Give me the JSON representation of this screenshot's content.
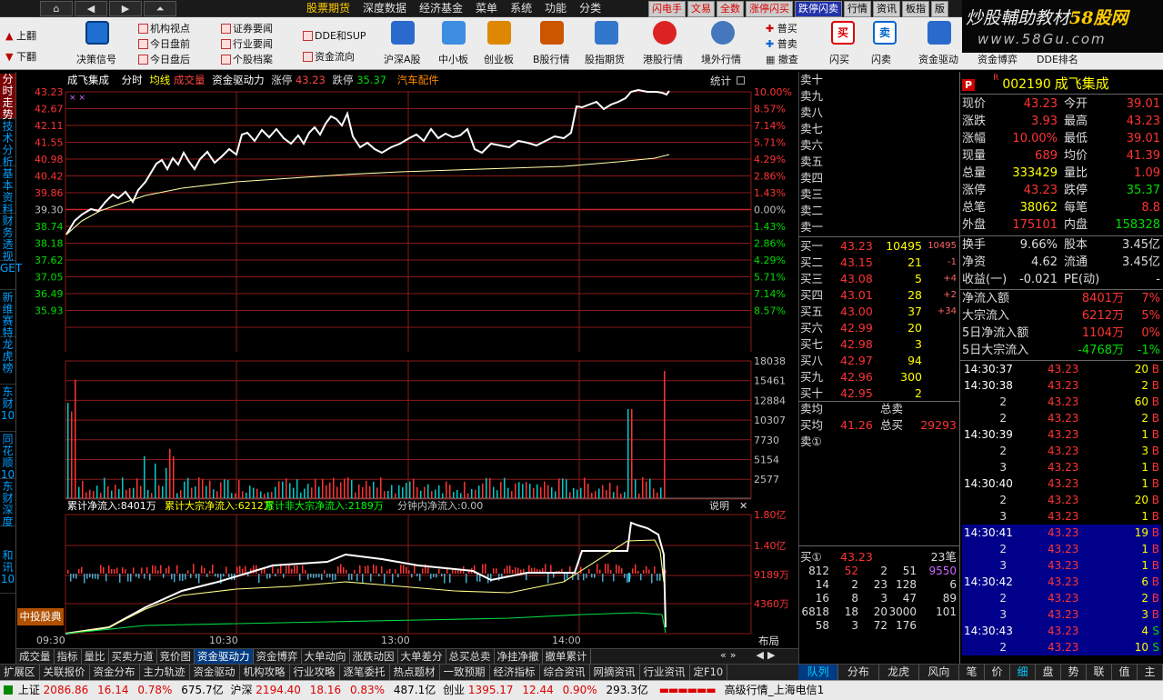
{
  "menubar": {
    "nav_home": "⌂",
    "nav_back": "◀",
    "nav_fwd": "▶",
    "nav_up": "⏶",
    "items": [
      "股票期货",
      "深度数据",
      "经济基金",
      "菜单",
      "系统",
      "功能",
      "分类"
    ],
    "hot": [
      "闪电手",
      "文易",
      "全数",
      "涨停闪买",
      "跌停闪卖",
      "行情",
      "资讯",
      "板指",
      "版"
    ]
  },
  "watermark": {
    "line1a": "炒股輔助教材",
    "line1b": "58股网",
    "line2": "www.58Gu.com"
  },
  "toolbar": {
    "page_up": "上翻",
    "page_down": "下翻",
    "decision": "决策信号",
    "col1": [
      "机构视点",
      "今日盘前",
      "今日盘后"
    ],
    "col2": [
      "证券要闻",
      "行业要闻",
      "个股档案"
    ],
    "col3": [
      "DDE和SUP",
      "资金流向"
    ],
    "big": [
      "沪深A股",
      "中小板",
      "创业板",
      "B股行情",
      "股指期货",
      "港股行情",
      "境外行情"
    ],
    "trade": [
      "普买",
      "普卖",
      "撤查"
    ],
    "flash": [
      "闪买",
      "闪卖"
    ],
    "fund": [
      "资金驱动",
      "资金博弈",
      "DDE排名"
    ]
  },
  "leftrail": [
    "分时走势",
    "技术分析",
    "基本资料",
    "财务透视",
    "GET",
    "新维赛特",
    "龙虎榜",
    "东财10",
    "同花顺10",
    "东财深度",
    "和讯10"
  ],
  "chart": {
    "title": {
      "name": "成飞集成",
      "mode": "分时",
      "avg": "均线",
      "vol": "成交量",
      "fund": "资金驱动力",
      "zt_label": "涨停",
      "zt": "43.23",
      "dt_label": "跌停",
      "dt": "35.37",
      "industry": "汽车配件",
      "stats": "统计"
    },
    "price_left": [
      "43.23",
      "42.67",
      "42.11",
      "41.55",
      "40.98",
      "40.42",
      "39.86",
      "39.30",
      "38.74",
      "38.18",
      "37.62",
      "37.05",
      "36.49",
      "35.93"
    ],
    "price_right": [
      "10.00%",
      "8.57%",
      "7.14%",
      "5.71%",
      "4.29%",
      "2.86%",
      "1.43%",
      "0.00%",
      "1.43%",
      "2.86%",
      "4.29%",
      "5.71%",
      "7.14%",
      "8.57%"
    ],
    "vol_right": [
      "18038",
      "15461",
      "12884",
      "10307",
      "7730",
      "5154",
      "2577"
    ],
    "flow_title": {
      "a": "累计净流入:8401万",
      "b": "累计大宗净流入:6212万",
      "c": "累计非大宗净流入:2189万",
      "d": "分钟内净流入:0.00",
      "e": "说明",
      "x": "✕"
    },
    "flow_right": [
      "1.80亿",
      "1.40亿",
      "9189万",
      "4360万"
    ],
    "badge": "中投股典",
    "times": [
      "09:30",
      "10:30",
      "13:00",
      "14:00"
    ],
    "layout": "布局",
    "pct_scale": {
      "top": "10.00%"
    }
  },
  "chart_tabs": [
    "成交量",
    "指标",
    "量比",
    "买卖力道",
    "竞价图",
    "资金驱动力",
    "资金博弈",
    "大单动向",
    "涨跌动因",
    "大单差分",
    "总买总卖",
    "净挂净撤",
    "撤单累计"
  ],
  "chart_tabs_arrows": [
    "«",
    "»",
    "◀",
    "▶"
  ],
  "sub_tabs": [
    "扩展区",
    "关联报价",
    "资金分布",
    "主力轨迹",
    "资金驱动",
    "机构攻略",
    "行业攻略",
    "逐笔委托",
    "热点题材",
    "一致预期",
    "经济指标",
    "综合资讯",
    "网摘资讯",
    "行业资讯",
    "定F10"
  ],
  "book": {
    "sell_labels": [
      "卖十",
      "卖九",
      "卖八",
      "卖七",
      "卖六",
      "卖五",
      "卖四",
      "卖三",
      "卖二",
      "卖一"
    ],
    "buy": [
      {
        "l": "买一",
        "p": "43.23",
        "v": "10495",
        "c": "10495"
      },
      {
        "l": "买二",
        "p": "43.15",
        "v": "21",
        "c": "-1"
      },
      {
        "l": "买三",
        "p": "43.08",
        "v": "5",
        "c": "+4"
      },
      {
        "l": "买四",
        "p": "43.01",
        "v": "28",
        "c": "+2"
      },
      {
        "l": "买五",
        "p": "43.00",
        "v": "37",
        "c": "+34"
      },
      {
        "l": "买六",
        "p": "42.99",
        "v": "20",
        "c": ""
      },
      {
        "l": "买七",
        "p": "42.98",
        "v": "3",
        "c": ""
      },
      {
        "l": "买八",
        "p": "42.97",
        "v": "94",
        "c": ""
      },
      {
        "l": "买九",
        "p": "42.96",
        "v": "300",
        "c": ""
      },
      {
        "l": "买十",
        "p": "42.95",
        "v": "2",
        "c": ""
      }
    ],
    "sell_avg": "卖均",
    "total_sell": "总卖",
    "buy_avg": "买均",
    "buy_avg_val": "41.26",
    "total_buy": "总买",
    "total_buy_val": "29293",
    "sell1": "卖①",
    "q_label": "买①",
    "q_price": "43.23",
    "q_count": "23笔",
    "q_rows": [
      [
        "812",
        "52",
        "2",
        "51",
        "9550"
      ],
      [
        "14",
        "2",
        "23",
        "128",
        "6"
      ],
      [
        "16",
        "8",
        "3",
        "47",
        "89"
      ],
      [
        "6818",
        "18",
        "20",
        "3000",
        "101"
      ],
      [
        "58",
        "3",
        "72",
        "176",
        ""
      ]
    ]
  },
  "rtabs": [
    "队列",
    "分布",
    "龙虎",
    "风向"
  ],
  "quote": {
    "code": "002190",
    "name": "成飞集成",
    "r": "R",
    "p": "P",
    "rows": [
      [
        "现价",
        "43.23",
        "今开",
        "39.01"
      ],
      [
        "涨跌",
        "3.93",
        "最高",
        "43.23"
      ],
      [
        "涨幅",
        "10.00%",
        "最低",
        "39.01"
      ],
      [
        "现量",
        "689",
        "均价",
        "41.39"
      ],
      [
        "总量",
        "333429",
        "量比",
        "1.09"
      ],
      [
        "涨停",
        "43.23",
        "跌停",
        "35.37"
      ],
      [
        "总笔",
        "38062",
        "每笔",
        "8.8"
      ],
      [
        "外盘",
        "175101",
        "内盘",
        "158328"
      ]
    ],
    "rows2": [
      [
        "换手",
        "9.66%",
        "股本",
        "3.45亿"
      ],
      [
        "净资",
        "4.62",
        "流通",
        "3.45亿"
      ],
      [
        "收益(一)",
        "-0.021",
        "PE(动)",
        "-"
      ]
    ],
    "flows": [
      [
        "净流入额",
        "8401万",
        "7%"
      ],
      [
        "大宗流入",
        "6212万",
        "5%"
      ],
      [
        "5日净流入额",
        "1104万",
        "0%"
      ],
      [
        "5日大宗流入",
        "-4768万",
        "-1%"
      ]
    ],
    "ticks": [
      [
        "14:30:37",
        "43.23",
        "20",
        "B"
      ],
      [
        "14:30:38",
        "43.23",
        "2",
        "B"
      ],
      [
        "2",
        "43.23",
        "60",
        "B"
      ],
      [
        "2",
        "43.23",
        "2",
        "B"
      ],
      [
        "14:30:39",
        "43.23",
        "1",
        "B"
      ],
      [
        "2",
        "43.23",
        "3",
        "B"
      ],
      [
        "3",
        "43.23",
        "1",
        "B"
      ],
      [
        "14:30:40",
        "43.23",
        "1",
        "B"
      ],
      [
        "2",
        "43.23",
        "20",
        "B"
      ],
      [
        "3",
        "43.23",
        "1",
        "B"
      ],
      [
        "14:30:41",
        "43.23",
        "19",
        "B"
      ],
      [
        "2",
        "43.23",
        "1",
        "B"
      ],
      [
        "3",
        "43.23",
        "1",
        "B"
      ],
      [
        "14:30:42",
        "43.23",
        "6",
        "B"
      ],
      [
        "2",
        "43.23",
        "2",
        "B"
      ],
      [
        "3",
        "43.23",
        "3",
        "B"
      ],
      [
        "14:30:43",
        "43.23",
        "4",
        "S"
      ],
      [
        "2",
        "43.23",
        "10",
        "S"
      ]
    ]
  },
  "r2tabs": [
    "笔",
    "价",
    "细",
    "盘",
    "势",
    "联",
    "值",
    "主"
  ],
  "status": {
    "sh": "上证",
    "sh_v": "2086.86",
    "sh_c": "16.14",
    "sh_p": "0.78%",
    "sh_a": "675.7亿",
    "sz": "沪深",
    "sz_v": "2194.40",
    "sz_c": "18.16",
    "sz_p": "0.83%",
    "sz_a": "487.1亿",
    "cy": "创业",
    "cy_v": "1395.17",
    "cy_c": "12.44",
    "cy_p": "0.90%",
    "cy_a": "293.3亿",
    "net": "高级行情_上海电信1"
  },
  "colors": {
    "up": "#ff3333",
    "down": "#00dd00",
    "label": "#c0c0c0",
    "accent": "#ffff00"
  }
}
